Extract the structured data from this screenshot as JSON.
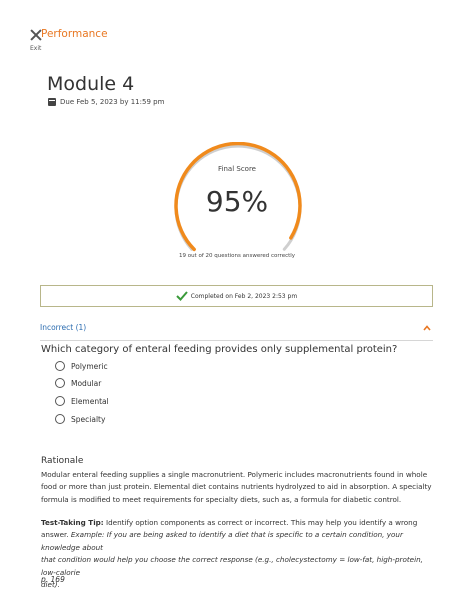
{
  "header": {
    "title": "Performance",
    "exit_label": "Exit"
  },
  "assignment": {
    "title": "Module 4",
    "due": "Due Feb 5, 2023 by 11:59 pm"
  },
  "score": {
    "label": "Final Score",
    "value": "95%",
    "percent": 95,
    "summary": "19 out of 20 questions answered correctly",
    "color": "#f08a1c"
  },
  "completion": {
    "text": "Completed on Feb 2, 2023 2:53 pm",
    "check_color": "#3a9a3a"
  },
  "incorrect_section": {
    "label": "Incorrect (1)",
    "accent": "#2b6cb0",
    "toggle_color": "#e87722"
  },
  "question": {
    "text": "Which category of enteral feeding provides only supplemental protein?",
    "options": [
      "Polymeric",
      "Modular",
      "Elemental",
      "Specialty"
    ]
  },
  "rationale": {
    "title": "Rationale",
    "body_lines": [
      "Modular enteral feeding supplies a single macronutrient. Polymeric includes macronutrients found in whole",
      "food or more than just protein. Elemental diet contains nutrients hydrolyzed to aid in absorption. A specialty",
      "formula is modified to meet requirements for specialty diets, such as, a formula for diabetic control."
    ],
    "tip_label": "Test-Taking Tip:",
    "tip_line1_rest": " Identify option components as correct or incorrect. This may help you identify a wrong",
    "tip_line2_prefix": "answer. ",
    "tip_line2_example": "Example: If you are being asked to identify a diet that is specific to a certain condition, your knowledge about",
    "tip_line3": "that condition would help you choose the correct response (e.g., cholecystectomy = low-fat, high-protein, low-calorie",
    "tip_line4": "diet).",
    "page_ref": "p. 169"
  }
}
